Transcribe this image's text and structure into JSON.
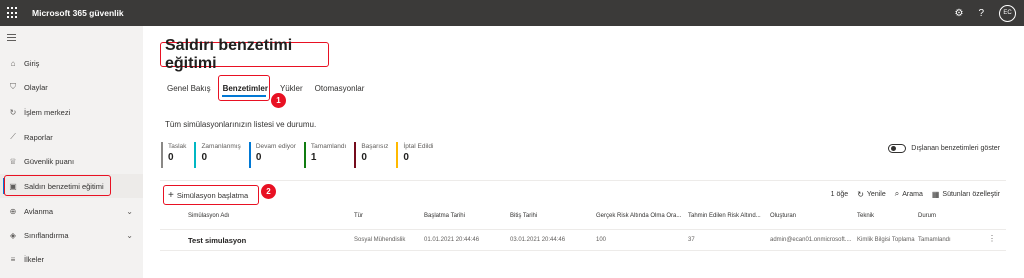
{
  "app": {
    "title": "Microsoft 365 güvenlik",
    "user_initials": "EC",
    "icons": [
      "waffle-icon",
      "settings-icon",
      "help-icon"
    ]
  },
  "sidebar": {
    "items": [
      {
        "label": "Giriş",
        "icon": "home-icon"
      },
      {
        "label": "Olaylar",
        "icon": "shield-icon"
      },
      {
        "label": "İşlem merkezi",
        "icon": "action-center-icon"
      },
      {
        "label": "Raporlar",
        "icon": "chart-icon"
      },
      {
        "label": "Güvenlik puanı",
        "icon": "trophy-icon"
      },
      {
        "label": "Saldırı benzetimi eğitimi",
        "icon": "attack-simulation-icon",
        "active": true
      },
      {
        "label": "Avlanma",
        "icon": "hunting-icon",
        "expandable": true
      },
      {
        "label": "Sınıflandırma",
        "icon": "classification-icon",
        "expandable": true
      },
      {
        "label": "İlkeler",
        "icon": "policies-icon"
      }
    ]
  },
  "page": {
    "title": "Saldırı benzetimi eğitimi",
    "tabs": [
      "Genel Bakış",
      "Benzetimler",
      "Yükler",
      "Otomasyonlar"
    ],
    "active_tab": "Benzetimler",
    "description": "Tüm simülasyonlarınızın listesi ve durumu.",
    "callouts": [
      "1",
      "2"
    ]
  },
  "statuses": [
    {
      "label": "Taslak",
      "value": "0",
      "color": "#8a8886"
    },
    {
      "label": "Zamanlanmış",
      "value": "0",
      "color": "#00b7c3"
    },
    {
      "label": "Devam ediyor",
      "value": "0",
      "color": "#0078d4"
    },
    {
      "label": "Tamamlandı",
      "value": "1",
      "color": "#107c10"
    },
    {
      "label": "Başarısız",
      "value": "0",
      "color": "#750b1c"
    },
    {
      "label": "İptal Edildi",
      "value": "0",
      "color": "#ffb900"
    }
  ],
  "toggle": {
    "label": "Dışlanan benzetimleri göster",
    "on": false
  },
  "toolbar": {
    "start_label": "Simülasyon başlatma",
    "count": "1 öğe",
    "refresh": "Yenile",
    "search": "Arama",
    "customize": "Sütunları özelleştir"
  },
  "table": {
    "columns": [
      "Simülasyon Adı",
      "Tür",
      "Başlatma Tarihi",
      "Bitiş Tarihi",
      "Gerçek Risk Altında Olma Ora...",
      "Tahmin Edilen Risk Altınd...",
      "Oluşturan",
      "Teknik",
      "Durum"
    ],
    "rows": [
      [
        "Test simulasyon",
        "Sosyal Mühendislik",
        "01.01.2021 20:44:46",
        "03.01.2021 20:44:46",
        "100",
        "37",
        "admin@ecan01.onmicrosoft....",
        "Kimlik Bilgisi Toplama",
        "Tamamlandı"
      ]
    ]
  }
}
